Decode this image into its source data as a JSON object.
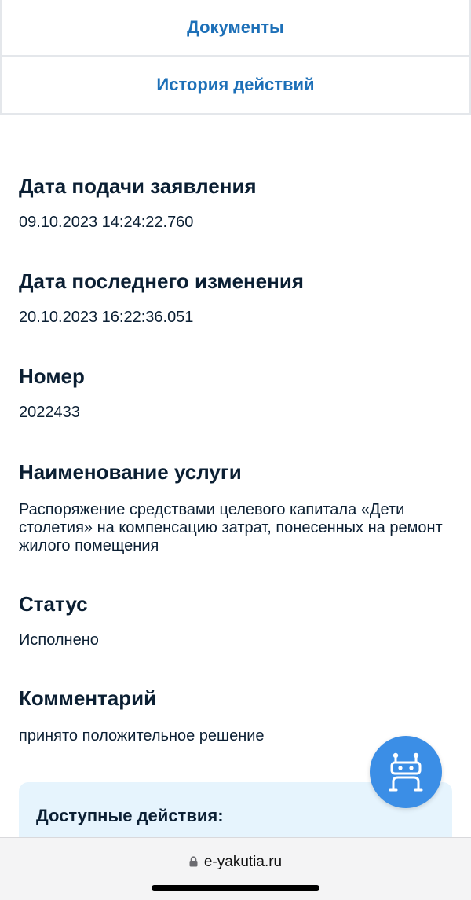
{
  "tabs": {
    "documents_label": "Документы",
    "history_label": "История действий"
  },
  "details": {
    "submission_date": {
      "label": "Дата подачи заявления",
      "value": "09.10.2023 14:24:22.760"
    },
    "last_modified": {
      "label": "Дата последнего изменения",
      "value": "20.10.2023 16:22:36.051"
    },
    "number": {
      "label": "Номер",
      "value": "2022433"
    },
    "service_name": {
      "label": "Наименование услуги",
      "value": "Распоряжение средствами целевого капитала «Дети столетия» на компенсацию затрат, понесенных на ремонт жилого помещения"
    },
    "status": {
      "label": "Статус",
      "value": "Исполнено"
    },
    "comment": {
      "label": "Комментарий",
      "value": "принято положительное решение"
    }
  },
  "actions": {
    "title": "Доступные действия:"
  },
  "browser": {
    "url": "e-yakutia.ru"
  },
  "icons": {
    "assistant": "robot-icon",
    "secure": "lock-icon"
  },
  "colors": {
    "link": "#1d70b8",
    "assistant_button": "#3b8ee6",
    "actions_panel": "#e6f4fd"
  }
}
